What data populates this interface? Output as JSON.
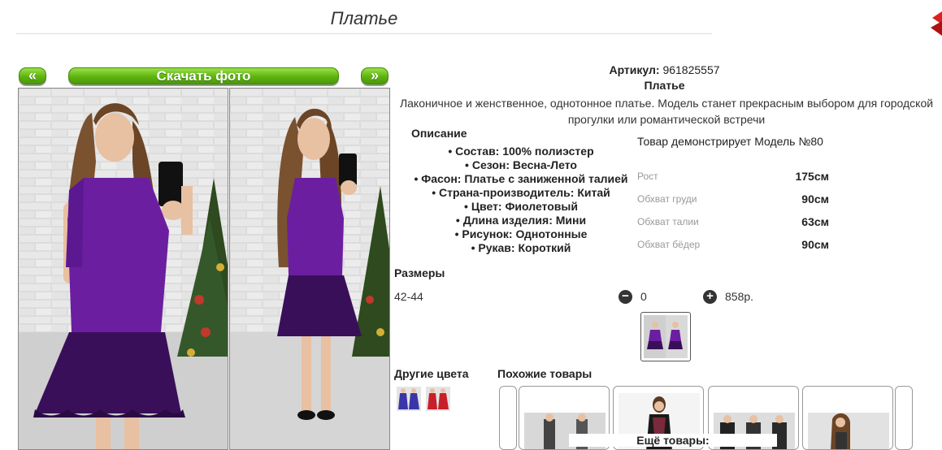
{
  "page": {
    "title": "Платье"
  },
  "nav": {
    "prev_label": "«",
    "download_label": "Скачать фото",
    "next_label": "»"
  },
  "product": {
    "article_label": "Артикул:",
    "article_value": "961825557",
    "name": "Платье",
    "description": "Лаконичное и женственное, однотонное платье. Модель станет прекрасным выбором для городской прогулки или романтической встречи",
    "features_heading": "Описание",
    "features": [
      "Состав: 100% полиэстер",
      "Сезон: Весна-Лето",
      "Фасон: Платье с заниженной талией",
      "Страна-производитель: Китай",
      "Цвет: Фиолетовый",
      "Длина изделия: Мини",
      "Рисунок: Однотонные",
      "Рукав: Короткий"
    ],
    "model_text": "Товар демонстрирует Модель №80",
    "measurements": [
      {
        "label": "Рост",
        "value": "175см"
      },
      {
        "label": "Обхват груди",
        "value": "90см"
      },
      {
        "label": "Обхват талии",
        "value": "63см"
      },
      {
        "label": "Обхват бёдер",
        "value": "90см"
      }
    ]
  },
  "sizes": {
    "heading": "Размеры",
    "rows": [
      {
        "size": "42-44",
        "quantity": "0",
        "price": "858р."
      }
    ],
    "minus_symbol": "−",
    "plus_symbol": "+"
  },
  "other_colors": {
    "heading": "Другие цвета",
    "swatch_colors": [
      "#3a36a8",
      "#c8202a"
    ]
  },
  "similar": {
    "heading": "Похожие товары",
    "more_label": "Ещё товары:"
  },
  "colors": {
    "accent_green": "#5fb30e",
    "dress_purple": "#6b1fa0",
    "dress_dark": "#3a0f5a",
    "brand_red": "#e02020"
  }
}
